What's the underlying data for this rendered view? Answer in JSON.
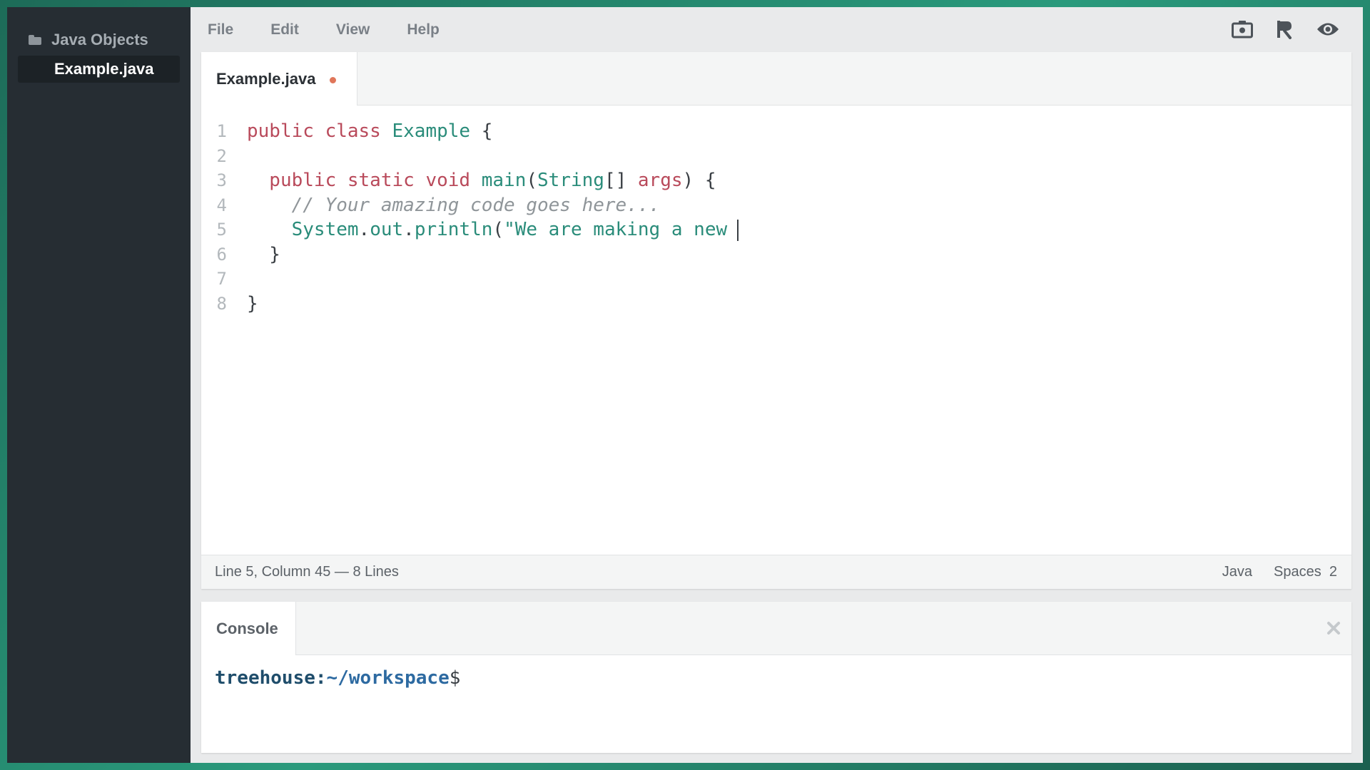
{
  "sidebar": {
    "folder": {
      "label": "Java Objects",
      "icon": "folder-icon"
    },
    "files": [
      {
        "label": "Example.java",
        "active": true
      }
    ]
  },
  "menubar": {
    "items": [
      "File",
      "Edit",
      "View",
      "Help"
    ],
    "icons": [
      "screenshot-icon",
      "share-icon",
      "preview-icon"
    ]
  },
  "editor": {
    "tab": {
      "label": "Example.java",
      "unsaved": true
    },
    "lines": [
      {
        "n": "1",
        "tokens": [
          {
            "t": "public class ",
            "c": "kw"
          },
          {
            "t": "Example",
            "c": "ty"
          },
          {
            "t": " {",
            "c": "pl"
          }
        ]
      },
      {
        "n": "2",
        "tokens": []
      },
      {
        "n": "3",
        "tokens": [
          {
            "t": "  public static void ",
            "c": "kw"
          },
          {
            "t": "main",
            "c": "ty"
          },
          {
            "t": "(",
            "c": "pl"
          },
          {
            "t": "String",
            "c": "ty"
          },
          {
            "t": "[] ",
            "c": "pl"
          },
          {
            "t": "args",
            "c": "kw"
          },
          {
            "t": ") {",
            "c": "pl"
          }
        ]
      },
      {
        "n": "4",
        "tokens": [
          {
            "t": "    // Your amazing code goes here...",
            "c": "cm"
          }
        ]
      },
      {
        "n": "5",
        "tokens": [
          {
            "t": "    System",
            "c": "ty"
          },
          {
            "t": ".",
            "c": "pl"
          },
          {
            "t": "out",
            "c": "ty"
          },
          {
            "t": ".",
            "c": "pl"
          },
          {
            "t": "println",
            "c": "ty"
          },
          {
            "t": "(",
            "c": "pl"
          },
          {
            "t": "\"We are making a new",
            "c": "ty"
          }
        ],
        "cursor": true
      },
      {
        "n": "6",
        "tokens": [
          {
            "t": "  }",
            "c": "pl"
          }
        ]
      },
      {
        "n": "7",
        "tokens": []
      },
      {
        "n": "8",
        "tokens": [
          {
            "t": "}",
            "c": "pl"
          }
        ]
      }
    ],
    "status": {
      "position": "Line 5, Column 45 — 8 Lines",
      "language": "Java",
      "indent": "Spaces  2"
    }
  },
  "console": {
    "tab_label": "Console",
    "prompt": {
      "user": "treehouse",
      "colon": ":",
      "path": "~/workspace",
      "dollar": "$"
    }
  },
  "colors": {
    "keyword": "#b94a5b",
    "type": "#2a8c7a",
    "comment": "#8f9599",
    "unsaved_dot": "#e0765a",
    "sidebar_bg": "#262d33"
  }
}
